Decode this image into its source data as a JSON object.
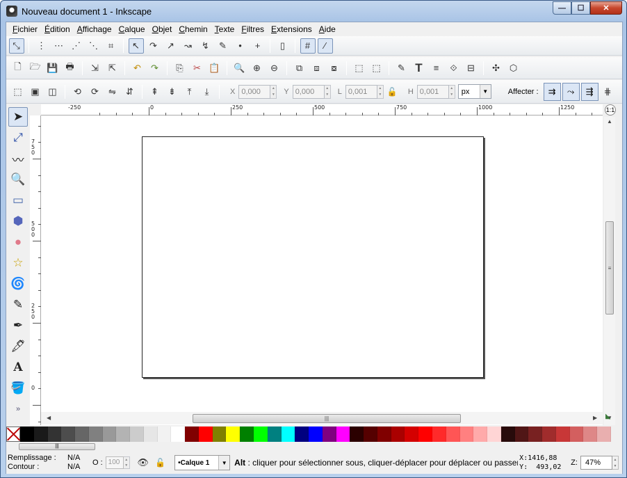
{
  "window": {
    "title": "Nouveau document 1 - Inkscape",
    "minimize": "—",
    "maximize": "☐",
    "close": "✕"
  },
  "menu": [
    "Fichier",
    "Édition",
    "Affichage",
    "Calque",
    "Objet",
    "Chemin",
    "Texte",
    "Filtres",
    "Extensions",
    "Aide"
  ],
  "snap_toolbar": [
    "⤡",
    "⋮",
    "⋯",
    "⋰",
    "⋱",
    "⌗",
    "↖",
    "↷",
    "↗",
    "↝",
    "↯",
    "✎",
    "•",
    "+",
    "▯",
    "#",
    "⁄"
  ],
  "commands_toolbar": [
    "🗋",
    "🗁",
    "💾",
    "🖶",
    "⇲",
    "⇱",
    "↶",
    "↷",
    "⎘",
    "✂",
    "📋",
    "🔍",
    "⊕",
    "⊖",
    "⧉",
    "⧈",
    "⧇",
    "⬚",
    "⬚",
    "✎",
    "T",
    "≡",
    "⟐",
    "⊟",
    "✣",
    "⬡"
  ],
  "select_toolbar": {
    "buttons": [
      "⬚",
      "▣",
      "◫",
      "⟲",
      "⟳",
      "⇋",
      "⇵",
      "⇞",
      "⇟",
      "⤒",
      "⤓"
    ],
    "x_label": "X",
    "x_value": "0,000",
    "y_label": "Y",
    "y_value": "0,000",
    "w_label": "L",
    "w_value": "0,001",
    "h_label": "H",
    "h_value": "0,001",
    "unit": "px",
    "affect_label": "Affecter :",
    "affect_buttons": [
      "⇉",
      "⤳",
      "⇶",
      "⋕"
    ]
  },
  "tools": [
    "➤",
    "⤢",
    "〰",
    "🔍",
    "▭",
    "⬢",
    "●",
    "☆",
    "🌀",
    "✎",
    "✒",
    "🖋",
    "A",
    "🪣"
  ],
  "tools_more": "»",
  "ruler_h": [
    "-250",
    "0",
    "250",
    "500",
    "750",
    "1000",
    "1250"
  ],
  "ruler_v": [
    "750",
    "500",
    "250",
    "0"
  ],
  "zoom_corner": "1:1",
  "palette": [
    "#000000",
    "#1a1a1a",
    "#333333",
    "#4d4d4d",
    "#666666",
    "#808080",
    "#999999",
    "#b3b3b3",
    "#cccccc",
    "#e6e6e6",
    "#f2f2f2",
    "#ffffff",
    "#800000",
    "#ff0000",
    "#808000",
    "#ffff00",
    "#008000",
    "#00ff00",
    "#008080",
    "#00ffff",
    "#000080",
    "#0000ff",
    "#800080",
    "#ff00ff",
    "#2b0000",
    "#550000",
    "#800000",
    "#aa0000",
    "#d40000",
    "#ff0000",
    "#ff2a2a",
    "#ff5555",
    "#ff8080",
    "#ffaaaa",
    "#ffd5d5",
    "#280b0b",
    "#501616",
    "#782121",
    "#a02c2c",
    "#c83737",
    "#d35f5f",
    "#de8787",
    "#e9afaf"
  ],
  "status": {
    "fill_label": "Remplissage :",
    "fill_value": "N/A",
    "stroke_label": "Contour :",
    "stroke_value": "N/A",
    "opacity_label": "O :",
    "opacity_value": "100",
    "layer": "•Calque 1",
    "message_bold": "Alt",
    "message": " : cliquer pour sélectionner sous, cliquer-déplacer pour déplacer ou passer",
    "x_coord": "X:1416,88",
    "y_coord": "Y:  493,02",
    "zoom_label": "Z:",
    "zoom_value": "47%"
  }
}
